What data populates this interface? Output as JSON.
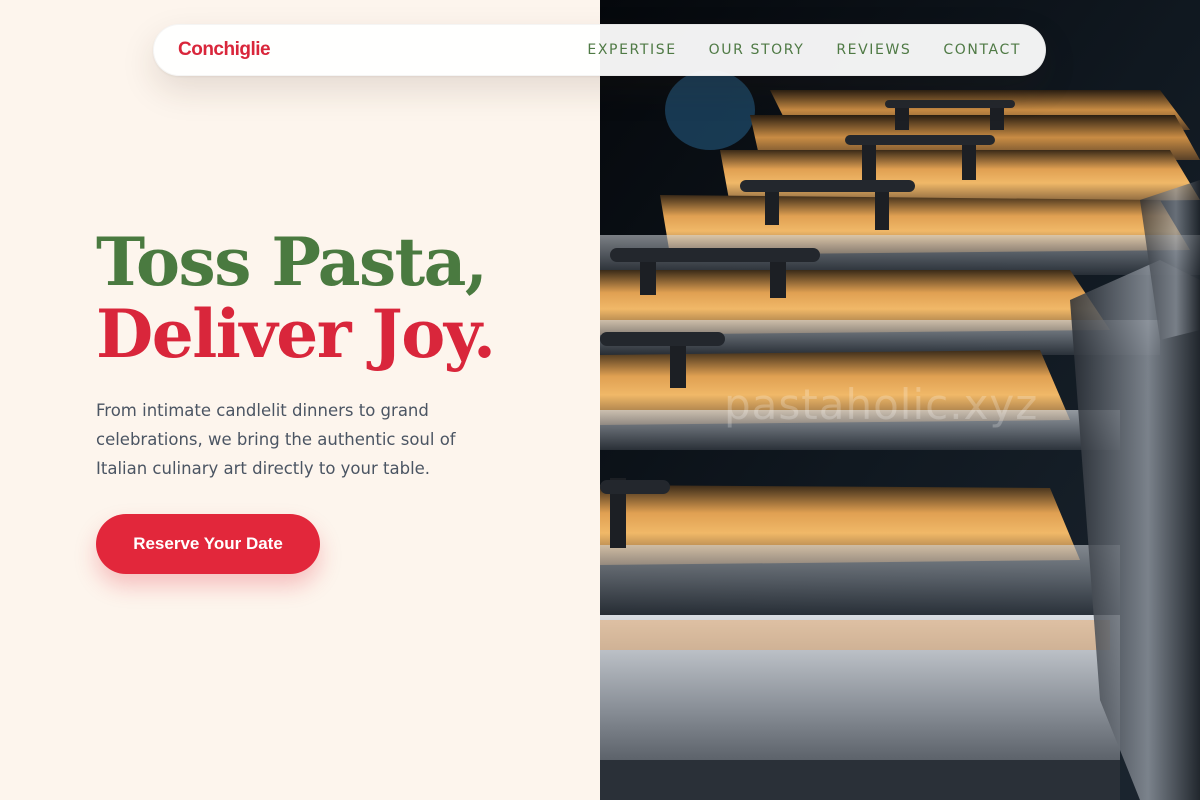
{
  "brand": {
    "name": "Conchiglie",
    "color": "#d9263b"
  },
  "nav": {
    "items": [
      {
        "label": "EXPERTISE"
      },
      {
        "label": "OUR STORY"
      },
      {
        "label": "REVIEWS"
      },
      {
        "label": "CONTACT"
      }
    ],
    "color": "#4f7a45"
  },
  "hero": {
    "title_line1": "Toss Pasta,",
    "title_line2": "Deliver Joy.",
    "description": "From intimate candlelit dinners to grand celebrations, we bring the authentic soul of Italian culinary art directly to your table.",
    "cta_label": "Reserve Your Date",
    "image_subject": "row of stainless steel chafing dishes under warm light"
  },
  "watermark": {
    "text": "pastaholic.xyz"
  },
  "colors": {
    "background": "#fdf5ed",
    "accent_red": "#e2273b",
    "accent_green": "#4a7a40",
    "body_text": "#4b5563"
  }
}
